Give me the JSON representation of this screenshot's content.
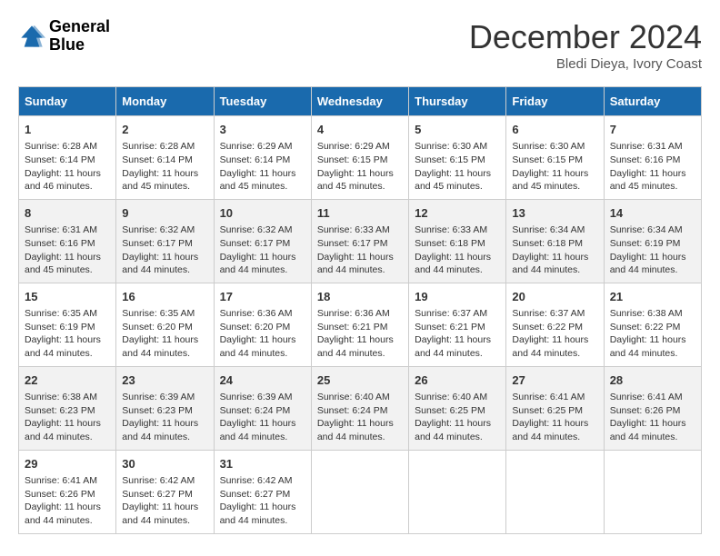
{
  "logo": {
    "line1": "General",
    "line2": "Blue"
  },
  "title": "December 2024",
  "location": "Bledi Dieya, Ivory Coast",
  "days_of_week": [
    "Sunday",
    "Monday",
    "Tuesday",
    "Wednesday",
    "Thursday",
    "Friday",
    "Saturday"
  ],
  "weeks": [
    [
      {
        "day": "1",
        "info": "Sunrise: 6:28 AM\nSunset: 6:14 PM\nDaylight: 11 hours\nand 46 minutes."
      },
      {
        "day": "2",
        "info": "Sunrise: 6:28 AM\nSunset: 6:14 PM\nDaylight: 11 hours\nand 45 minutes."
      },
      {
        "day": "3",
        "info": "Sunrise: 6:29 AM\nSunset: 6:14 PM\nDaylight: 11 hours\nand 45 minutes."
      },
      {
        "day": "4",
        "info": "Sunrise: 6:29 AM\nSunset: 6:15 PM\nDaylight: 11 hours\nand 45 minutes."
      },
      {
        "day": "5",
        "info": "Sunrise: 6:30 AM\nSunset: 6:15 PM\nDaylight: 11 hours\nand 45 minutes."
      },
      {
        "day": "6",
        "info": "Sunrise: 6:30 AM\nSunset: 6:15 PM\nDaylight: 11 hours\nand 45 minutes."
      },
      {
        "day": "7",
        "info": "Sunrise: 6:31 AM\nSunset: 6:16 PM\nDaylight: 11 hours\nand 45 minutes."
      }
    ],
    [
      {
        "day": "8",
        "info": "Sunrise: 6:31 AM\nSunset: 6:16 PM\nDaylight: 11 hours\nand 45 minutes."
      },
      {
        "day": "9",
        "info": "Sunrise: 6:32 AM\nSunset: 6:17 PM\nDaylight: 11 hours\nand 44 minutes."
      },
      {
        "day": "10",
        "info": "Sunrise: 6:32 AM\nSunset: 6:17 PM\nDaylight: 11 hours\nand 44 minutes."
      },
      {
        "day": "11",
        "info": "Sunrise: 6:33 AM\nSunset: 6:17 PM\nDaylight: 11 hours\nand 44 minutes."
      },
      {
        "day": "12",
        "info": "Sunrise: 6:33 AM\nSunset: 6:18 PM\nDaylight: 11 hours\nand 44 minutes."
      },
      {
        "day": "13",
        "info": "Sunrise: 6:34 AM\nSunset: 6:18 PM\nDaylight: 11 hours\nand 44 minutes."
      },
      {
        "day": "14",
        "info": "Sunrise: 6:34 AM\nSunset: 6:19 PM\nDaylight: 11 hours\nand 44 minutes."
      }
    ],
    [
      {
        "day": "15",
        "info": "Sunrise: 6:35 AM\nSunset: 6:19 PM\nDaylight: 11 hours\nand 44 minutes."
      },
      {
        "day": "16",
        "info": "Sunrise: 6:35 AM\nSunset: 6:20 PM\nDaylight: 11 hours\nand 44 minutes."
      },
      {
        "day": "17",
        "info": "Sunrise: 6:36 AM\nSunset: 6:20 PM\nDaylight: 11 hours\nand 44 minutes."
      },
      {
        "day": "18",
        "info": "Sunrise: 6:36 AM\nSunset: 6:21 PM\nDaylight: 11 hours\nand 44 minutes."
      },
      {
        "day": "19",
        "info": "Sunrise: 6:37 AM\nSunset: 6:21 PM\nDaylight: 11 hours\nand 44 minutes."
      },
      {
        "day": "20",
        "info": "Sunrise: 6:37 AM\nSunset: 6:22 PM\nDaylight: 11 hours\nand 44 minutes."
      },
      {
        "day": "21",
        "info": "Sunrise: 6:38 AM\nSunset: 6:22 PM\nDaylight: 11 hours\nand 44 minutes."
      }
    ],
    [
      {
        "day": "22",
        "info": "Sunrise: 6:38 AM\nSunset: 6:23 PM\nDaylight: 11 hours\nand 44 minutes."
      },
      {
        "day": "23",
        "info": "Sunrise: 6:39 AM\nSunset: 6:23 PM\nDaylight: 11 hours\nand 44 minutes."
      },
      {
        "day": "24",
        "info": "Sunrise: 6:39 AM\nSunset: 6:24 PM\nDaylight: 11 hours\nand 44 minutes."
      },
      {
        "day": "25",
        "info": "Sunrise: 6:40 AM\nSunset: 6:24 PM\nDaylight: 11 hours\nand 44 minutes."
      },
      {
        "day": "26",
        "info": "Sunrise: 6:40 AM\nSunset: 6:25 PM\nDaylight: 11 hours\nand 44 minutes."
      },
      {
        "day": "27",
        "info": "Sunrise: 6:41 AM\nSunset: 6:25 PM\nDaylight: 11 hours\nand 44 minutes."
      },
      {
        "day": "28",
        "info": "Sunrise: 6:41 AM\nSunset: 6:26 PM\nDaylight: 11 hours\nand 44 minutes."
      }
    ],
    [
      {
        "day": "29",
        "info": "Sunrise: 6:41 AM\nSunset: 6:26 PM\nDaylight: 11 hours\nand 44 minutes."
      },
      {
        "day": "30",
        "info": "Sunrise: 6:42 AM\nSunset: 6:27 PM\nDaylight: 11 hours\nand 44 minutes."
      },
      {
        "day": "31",
        "info": "Sunrise: 6:42 AM\nSunset: 6:27 PM\nDaylight: 11 hours\nand 44 minutes."
      },
      {
        "day": "",
        "info": ""
      },
      {
        "day": "",
        "info": ""
      },
      {
        "day": "",
        "info": ""
      },
      {
        "day": "",
        "info": ""
      }
    ]
  ]
}
